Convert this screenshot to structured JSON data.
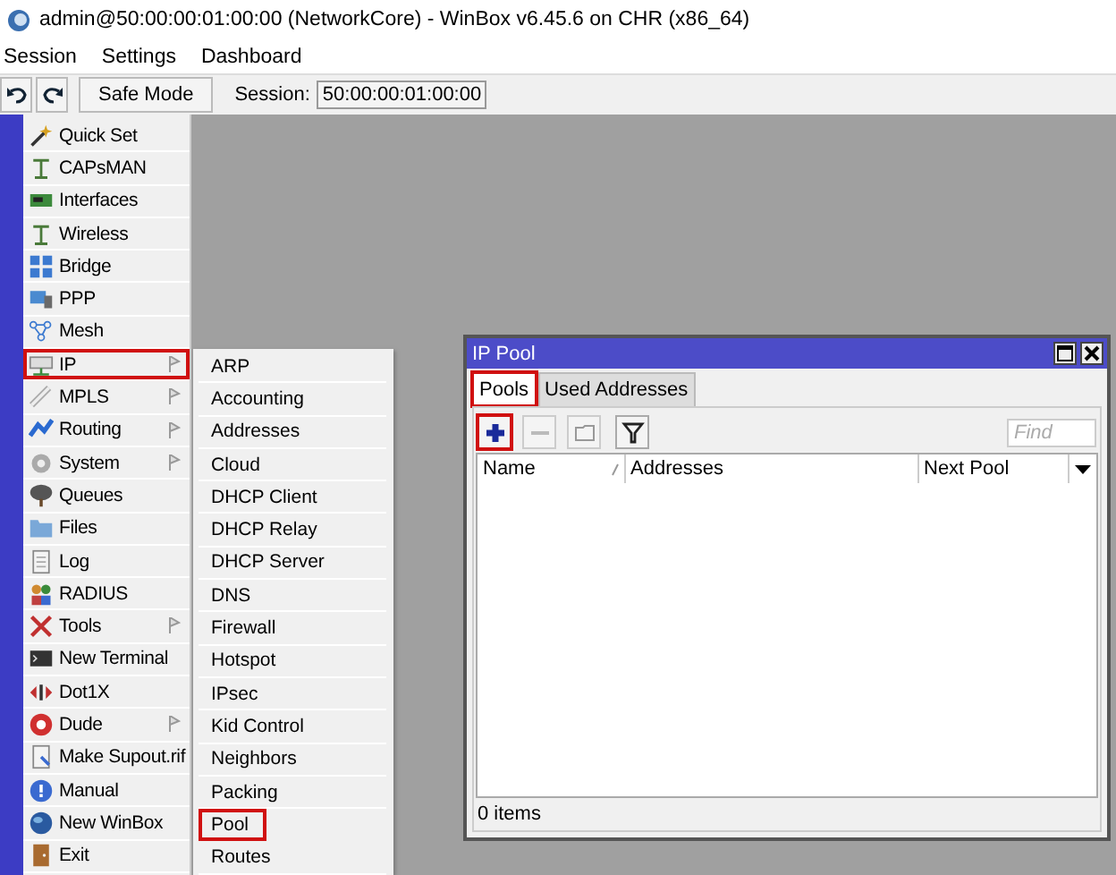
{
  "window": {
    "title": "admin@50:00:00:01:00:00 (NetworkCore) - WinBox v6.45.6 on CHR (x86_64)"
  },
  "menu_bar": [
    "Session",
    "Settings",
    "Dashboard"
  ],
  "toolbar": {
    "buttons": [
      {
        "kind": "undo"
      },
      {
        "kind": "redo"
      }
    ],
    "safe_mode": "Safe Mode",
    "session_label": "Session:",
    "session_value": "50:00:00:01:00:00"
  },
  "main_menu": [
    {
      "label": "Quick Set",
      "submenu": false,
      "highlighted": false
    },
    {
      "label": "CAPsMAN",
      "submenu": false,
      "highlighted": false
    },
    {
      "label": "Interfaces",
      "submenu": false,
      "highlighted": false
    },
    {
      "label": "Wireless",
      "submenu": false,
      "highlighted": false
    },
    {
      "label": "Bridge",
      "submenu": false,
      "highlighted": false
    },
    {
      "label": "PPP",
      "submenu": false,
      "highlighted": false
    },
    {
      "label": "Mesh",
      "submenu": false,
      "highlighted": false
    },
    {
      "label": "IP",
      "submenu": true,
      "highlighted": true
    },
    {
      "label": "MPLS",
      "submenu": true,
      "highlighted": false
    },
    {
      "label": "Routing",
      "submenu": true,
      "highlighted": false
    },
    {
      "label": "System",
      "submenu": true,
      "highlighted": false
    },
    {
      "label": "Queues",
      "submenu": false,
      "highlighted": false
    },
    {
      "label": "Files",
      "submenu": false,
      "highlighted": false
    },
    {
      "label": "Log",
      "submenu": false,
      "highlighted": false
    },
    {
      "label": "RADIUS",
      "submenu": false,
      "highlighted": false
    },
    {
      "label": "Tools",
      "submenu": true,
      "highlighted": false
    },
    {
      "label": "New Terminal",
      "submenu": false,
      "highlighted": false
    },
    {
      "label": "Dot1X",
      "submenu": false,
      "highlighted": false
    },
    {
      "label": "Dude",
      "submenu": true,
      "highlighted": false
    },
    {
      "label": "Make Supout.rif",
      "submenu": false,
      "highlighted": false
    },
    {
      "label": "Manual",
      "submenu": false,
      "highlighted": false
    },
    {
      "label": "New WinBox",
      "submenu": false,
      "highlighted": false
    },
    {
      "label": "Exit",
      "submenu": false,
      "highlighted": false
    }
  ],
  "submenu": [
    {
      "label": "ARP",
      "highlighted": false
    },
    {
      "label": "Accounting",
      "highlighted": false
    },
    {
      "label": "Addresses",
      "highlighted": false
    },
    {
      "label": "Cloud",
      "highlighted": false
    },
    {
      "label": "DHCP Client",
      "highlighted": false
    },
    {
      "label": "DHCP Relay",
      "highlighted": false
    },
    {
      "label": "DHCP Server",
      "highlighted": false
    },
    {
      "label": "DNS",
      "highlighted": false
    },
    {
      "label": "Firewall",
      "highlighted": false
    },
    {
      "label": "Hotspot",
      "highlighted": false
    },
    {
      "label": "IPsec",
      "highlighted": false
    },
    {
      "label": "Kid Control",
      "highlighted": false
    },
    {
      "label": "Neighbors",
      "highlighted": false
    },
    {
      "label": "Packing",
      "highlighted": false
    },
    {
      "label": "Pool",
      "highlighted": true
    },
    {
      "label": "Routes",
      "highlighted": false
    }
  ],
  "ip_pool_window": {
    "title": "IP Pool",
    "tabs": [
      {
        "label": "Pools",
        "selected": true,
        "highlighted": true
      },
      {
        "label": "Used Addresses",
        "selected": false,
        "highlighted": false
      }
    ],
    "toolbar": [
      {
        "kind": "add",
        "disabled": false,
        "highlighted": true
      },
      {
        "kind": "remove",
        "disabled": true,
        "highlighted": false
      },
      {
        "kind": "comment",
        "disabled": true,
        "highlighted": false
      },
      {
        "kind": "filter",
        "disabled": false,
        "highlighted": false
      }
    ],
    "find": {
      "placeholder": "Find"
    },
    "columns": [
      {
        "label": "Name",
        "sorted": true
      },
      {
        "label": "Addresses",
        "sorted": false
      },
      {
        "label": "Next Pool",
        "sorted": false
      }
    ],
    "status": "0 items"
  }
}
